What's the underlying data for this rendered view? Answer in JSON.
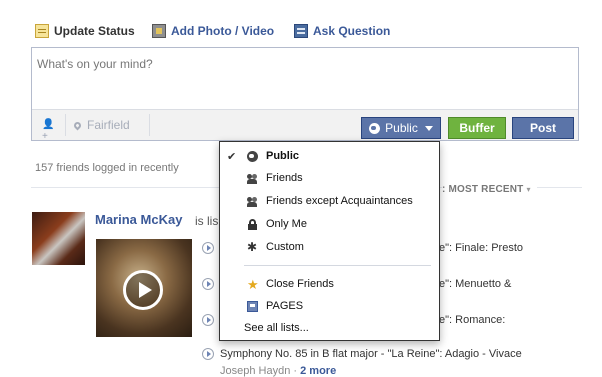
{
  "composer": {
    "tabs": [
      {
        "label": "Update Status",
        "icon": "status-icon"
      },
      {
        "label": "Add Photo / Video",
        "icon": "photo-icon"
      },
      {
        "label": "Ask Question",
        "icon": "question-icon"
      }
    ],
    "placeholder": "What's on your mind?",
    "location": "Fairfield",
    "privacy_label": "Public",
    "buffer_label": "Buffer",
    "post_label": "Post"
  },
  "feed": {
    "friends_online": "157 friends logged in recently",
    "sort_label": ": MOST RECENT",
    "sort_caret": "▾",
    "story": {
      "author": "Marina McKay",
      "action_partial": "is lis",
      "tracks": [
        {
          "visible_tail": "e\": Finale: Presto"
        },
        {
          "visible_tail": "e\": Menuetto &"
        },
        {
          "visible_tail": "e\": Romance:"
        },
        {
          "text": "Symphony No. 85 in B flat major - \"La Reine\": Adagio - Vivace"
        }
      ],
      "artist": "Joseph Haydn",
      "more_label": "2 more"
    }
  },
  "privacy_menu": {
    "items": [
      {
        "label": "Public",
        "icon": "globe-icon",
        "checked": true
      },
      {
        "label": "Friends",
        "icon": "friends-icon",
        "checked": false
      },
      {
        "label": "Friends except Acquaintances",
        "icon": "friends-except-icon",
        "checked": false
      },
      {
        "label": "Only Me",
        "icon": "lock-icon",
        "checked": false
      },
      {
        "label": "Custom",
        "icon": "gear-icon",
        "checked": false
      }
    ],
    "lists": [
      {
        "label": "Close Friends",
        "icon": "star-icon"
      },
      {
        "label": "PAGES",
        "icon": "pages-icon"
      }
    ],
    "see_all": "See all lists..."
  },
  "colors": {
    "brand_blue": "#3b5998",
    "button_blue": "#5b74a8",
    "buffer_green": "#6fb33f"
  }
}
